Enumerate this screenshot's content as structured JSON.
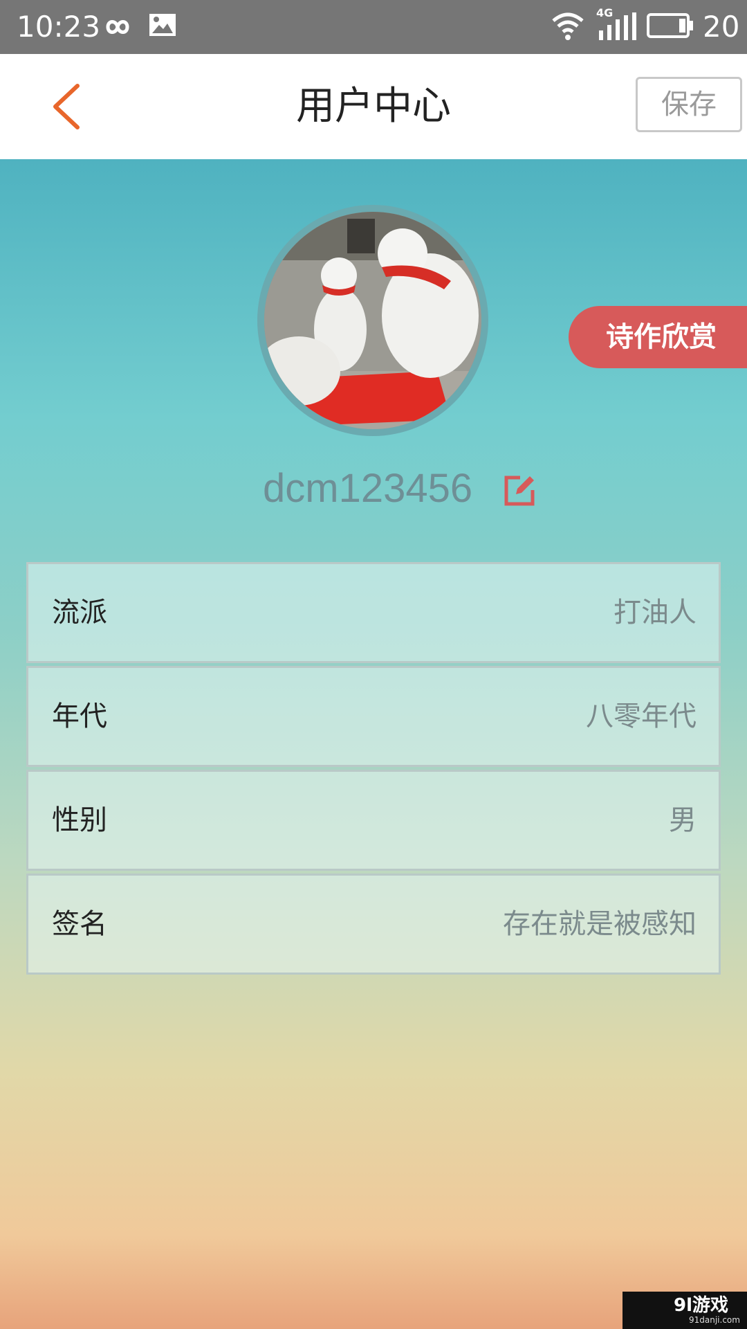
{
  "status_bar": {
    "time": "10:23",
    "network": "4G",
    "battery": "20",
    "icons": [
      "infinity-icon",
      "image-icon",
      "wifi-icon",
      "signal-icon",
      "battery-icon"
    ]
  },
  "header": {
    "title": "用户中心",
    "save_label": "保存",
    "back_icon": "chevron-left-icon"
  },
  "profile": {
    "username": "dcm123456",
    "ribbon_label": "诗作欣赏",
    "edit_icon": "edit-icon"
  },
  "fields": [
    {
      "label": "流派",
      "value": "打油人"
    },
    {
      "label": "年代",
      "value": "八零年代"
    },
    {
      "label": "性别",
      "value": "男"
    },
    {
      "label": "签名",
      "value": "存在就是被感知"
    }
  ],
  "watermark": {
    "main": "9l游戏",
    "sub": "91danji.com"
  },
  "colors": {
    "accent": "#e8662b",
    "ribbon": "#d75a5a",
    "status_bar": "#767676"
  }
}
